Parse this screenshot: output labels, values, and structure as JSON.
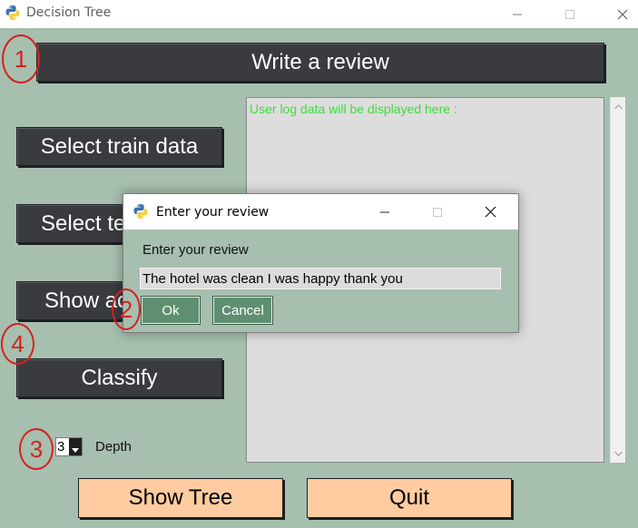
{
  "window": {
    "title": "Decision Tree"
  },
  "header": {
    "write_review_label": "Write a review"
  },
  "left_panel": {
    "select_train_label": "Select train data",
    "select_test_label": "Select test data",
    "show_label": "Show accuracy",
    "classify_label": "Classify"
  },
  "log": {
    "placeholder_text": "User log data will be displayed here :"
  },
  "depth": {
    "value": "3",
    "label": "Depth"
  },
  "footer": {
    "show_tree_label": "Show Tree",
    "quit_label": "Quit"
  },
  "annotations": [
    "1",
    "2",
    "3",
    "4"
  ],
  "dialog": {
    "title": "Enter your review",
    "prompt": "Enter your review",
    "input_value": "The hotel was clean I was happy thank you",
    "ok_label": "Ok",
    "cancel_label": "Cancel"
  },
  "colors": {
    "background": "#a6bfae",
    "dark_button": "#393b3f",
    "light_button": "#fecca0",
    "log_text": "#39e039",
    "annotation": "#d62020",
    "dialog_button": "#5f8f71"
  },
  "icons": [
    "python-icon",
    "minimize-icon",
    "maximize-icon",
    "close-icon",
    "scroll-up-icon",
    "scroll-down-icon",
    "dropdown-arrow-icon"
  ]
}
